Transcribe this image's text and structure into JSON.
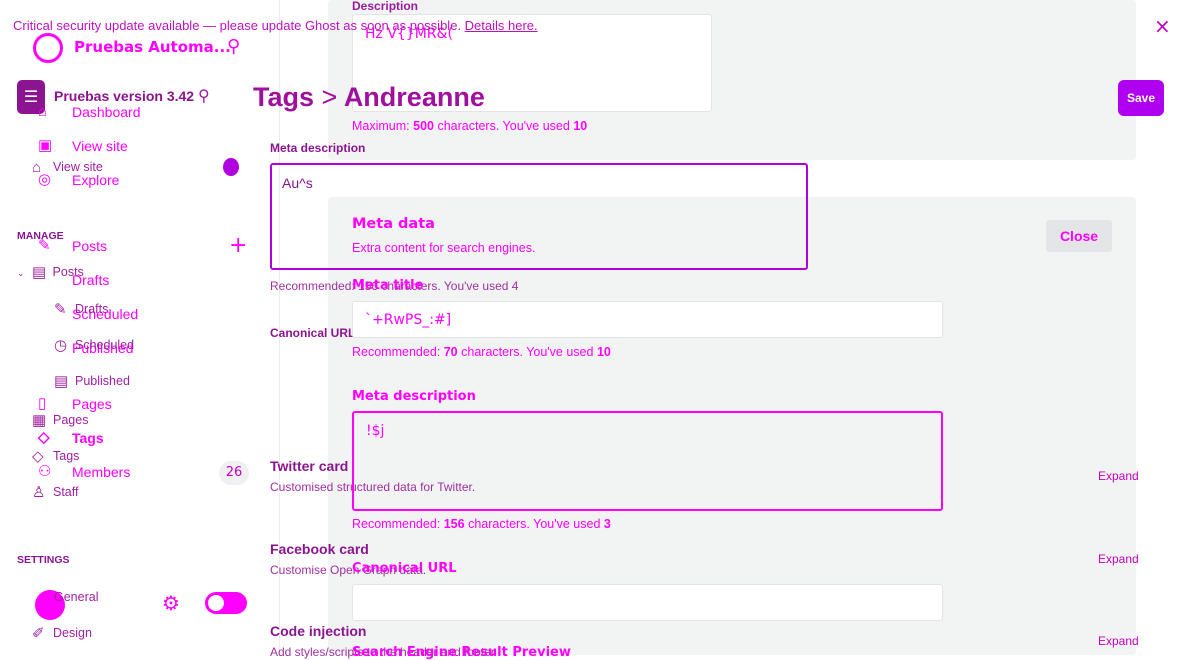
{
  "banner": {
    "text": "Critical security update available — please update Ghost as soon as possible.",
    "link": "Details here."
  },
  "site_a": {
    "name": "Pruebas Automa..."
  },
  "site_b": {
    "name": "Pruebas version 3.42"
  },
  "breadcrumb": {
    "parent": "Tags",
    "separator": ">",
    "current": "Andreanne"
  },
  "save_label": "Save",
  "close_label": "Close",
  "sidebar_a": {
    "dashboard": "Dashboard",
    "view_site": "View site",
    "explore": "Explore",
    "posts": "Posts",
    "drafts": "Drafts",
    "scheduled": "Scheduled",
    "published": "Published",
    "pages": "Pages",
    "tags": "Tags",
    "members": "Members",
    "members_count": "26"
  },
  "sidebar_b": {
    "view_site": "View site",
    "manage": "MANAGE",
    "posts": "Posts",
    "drafts": "Drafts",
    "scheduled": "Scheduled",
    "published": "Published",
    "pages": "Pages",
    "tags": "Tags",
    "staff": "Staff",
    "settings": "SETTINGS",
    "general": "General",
    "design": "Design"
  },
  "form_top": {
    "description_label": "Description",
    "description_value": "Hz V{}MR&(",
    "description_hint_pre": "Maximum:",
    "description_max": "500",
    "description_hint_mid": "characters. You've used",
    "description_used": "10"
  },
  "form_b": {
    "meta_desc_label": "Meta description",
    "meta_desc_value": "Au^s",
    "meta_desc_hint": "Recommended: 156 characters. You've used 4",
    "canonical_label": "Canonical URL",
    "twitter_title": "Twitter card",
    "twitter_desc": "Customised structured data for Twitter.",
    "facebook_title": "Facebook card",
    "facebook_desc": "Customise Open Graph data.",
    "code_title": "Code injection",
    "code_desc": "Add styles/scripts to the header and footer",
    "expand": "Expand"
  },
  "meta_panel": {
    "title": "Meta data",
    "subtitle": "Extra content for search engines.",
    "meta_title_label": "Meta title",
    "meta_title_value": "`+RwPS_:#]",
    "meta_title_hint_pre": "Recommended:",
    "meta_title_rec": "70",
    "meta_title_hint_mid": "characters. You've used",
    "meta_title_used": "10",
    "meta_desc_label": "Meta description",
    "meta_desc_value": "!$j",
    "meta_desc_hint_pre": "Recommended:",
    "meta_desc_rec": "156",
    "meta_desc_hint_mid": "characters. You've used",
    "meta_desc_used": "3",
    "canonical_label": "Canonical URL",
    "canonical_value": "",
    "search_preview": "Search Engine Result Preview"
  }
}
